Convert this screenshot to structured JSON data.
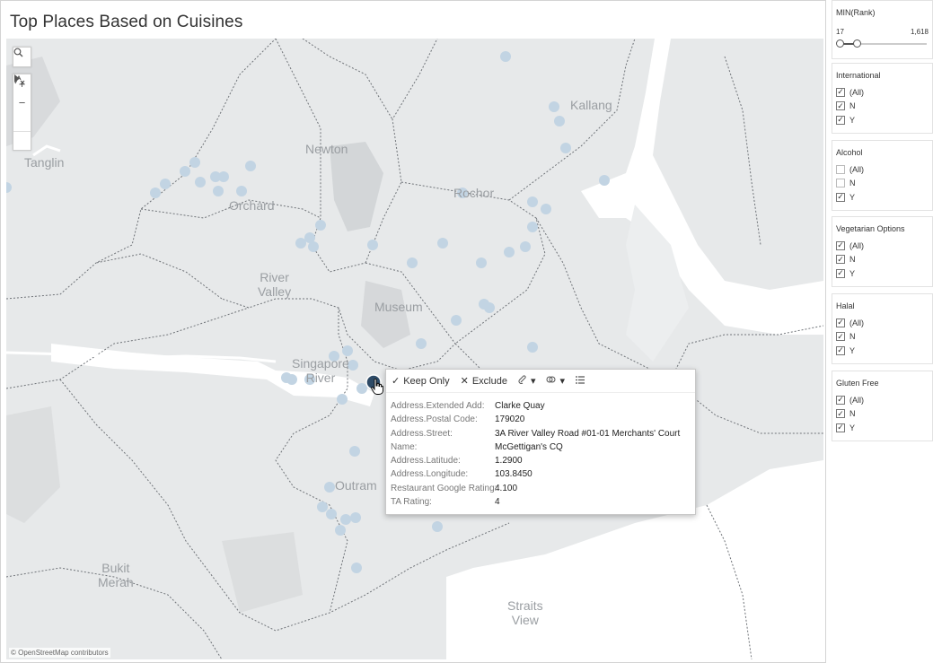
{
  "title": "Top Places Based on Cuisines",
  "map": {
    "attribution": "© OpenStreetMap contributors",
    "place_labels": [
      {
        "text": "Kallang"
      },
      {
        "text": "Tanglin"
      },
      {
        "text": "Newton"
      },
      {
        "text": "Rochor"
      },
      {
        "text": "Orchard"
      },
      {
        "text": "River\nValley"
      },
      {
        "text": "Museum"
      },
      {
        "text": "Singapore\nRiver"
      },
      {
        "text": "Outram"
      },
      {
        "text": "Bukit\nMerah"
      },
      {
        "text": "Straits\nView"
      }
    ],
    "controls": {
      "search_icon": "search-icon",
      "zoom_in": "+",
      "zoom_out": "−",
      "reset_icon": "reset-axes-icon",
      "expand_icon": "play-icon"
    },
    "marker_color": "#c2d4e3",
    "selected_marker_color": "#2d4a66"
  },
  "tooltip": {
    "actions": [
      {
        "icon": "✓",
        "label": "Keep Only"
      },
      {
        "icon": "✕",
        "label": "Exclude"
      },
      {
        "icon": "group-icon",
        "label": "▾"
      },
      {
        "icon": "set-icon",
        "label": "▾"
      },
      {
        "icon": "view-data-icon",
        "label": ""
      }
    ],
    "rows": [
      {
        "key": "Address.Extended Add:",
        "value": " Clarke Quay"
      },
      {
        "key": "Address.Postal Code:",
        "value": "179020"
      },
      {
        "key": "Address.Street:",
        "value": "3A River Valley Road #01-01 Merchants' Court"
      },
      {
        "key": "Name:",
        "value": "McGettigan's CQ"
      },
      {
        "key": "Address.Latitude:",
        "value": "1.2900"
      },
      {
        "key": "Address.Longitude:",
        "value": "103.8450"
      },
      {
        "key": "Restaurant Google Rating:",
        "value": "4.100"
      },
      {
        "key": "TA Rating:",
        "value": "4"
      }
    ]
  },
  "filters": {
    "rank": {
      "title": "MIN(Rank)",
      "min": "17",
      "max": "1,618",
      "selected_fraction": 0.2
    },
    "cards": [
      {
        "title": "International",
        "items": [
          {
            "label": "(All)",
            "checked": true
          },
          {
            "label": "N",
            "checked": true
          },
          {
            "label": "Y",
            "checked": true
          }
        ]
      },
      {
        "title": "Alcohol",
        "items": [
          {
            "label": "(All)",
            "checked": false
          },
          {
            "label": "N",
            "checked": false
          },
          {
            "label": "Y",
            "checked": true
          }
        ]
      },
      {
        "title": "Vegetarian Options",
        "items": [
          {
            "label": "(All)",
            "checked": true
          },
          {
            "label": "N",
            "checked": true
          },
          {
            "label": "Y",
            "checked": true
          }
        ]
      },
      {
        "title": "Halal",
        "items": [
          {
            "label": "(All)",
            "checked": true
          },
          {
            "label": "N",
            "checked": true
          },
          {
            "label": "Y",
            "checked": true
          }
        ]
      },
      {
        "title": "Gluten Free",
        "items": [
          {
            "label": "(All)",
            "checked": true
          },
          {
            "label": "N",
            "checked": true
          },
          {
            "label": "Y",
            "checked": true
          }
        ]
      }
    ]
  }
}
